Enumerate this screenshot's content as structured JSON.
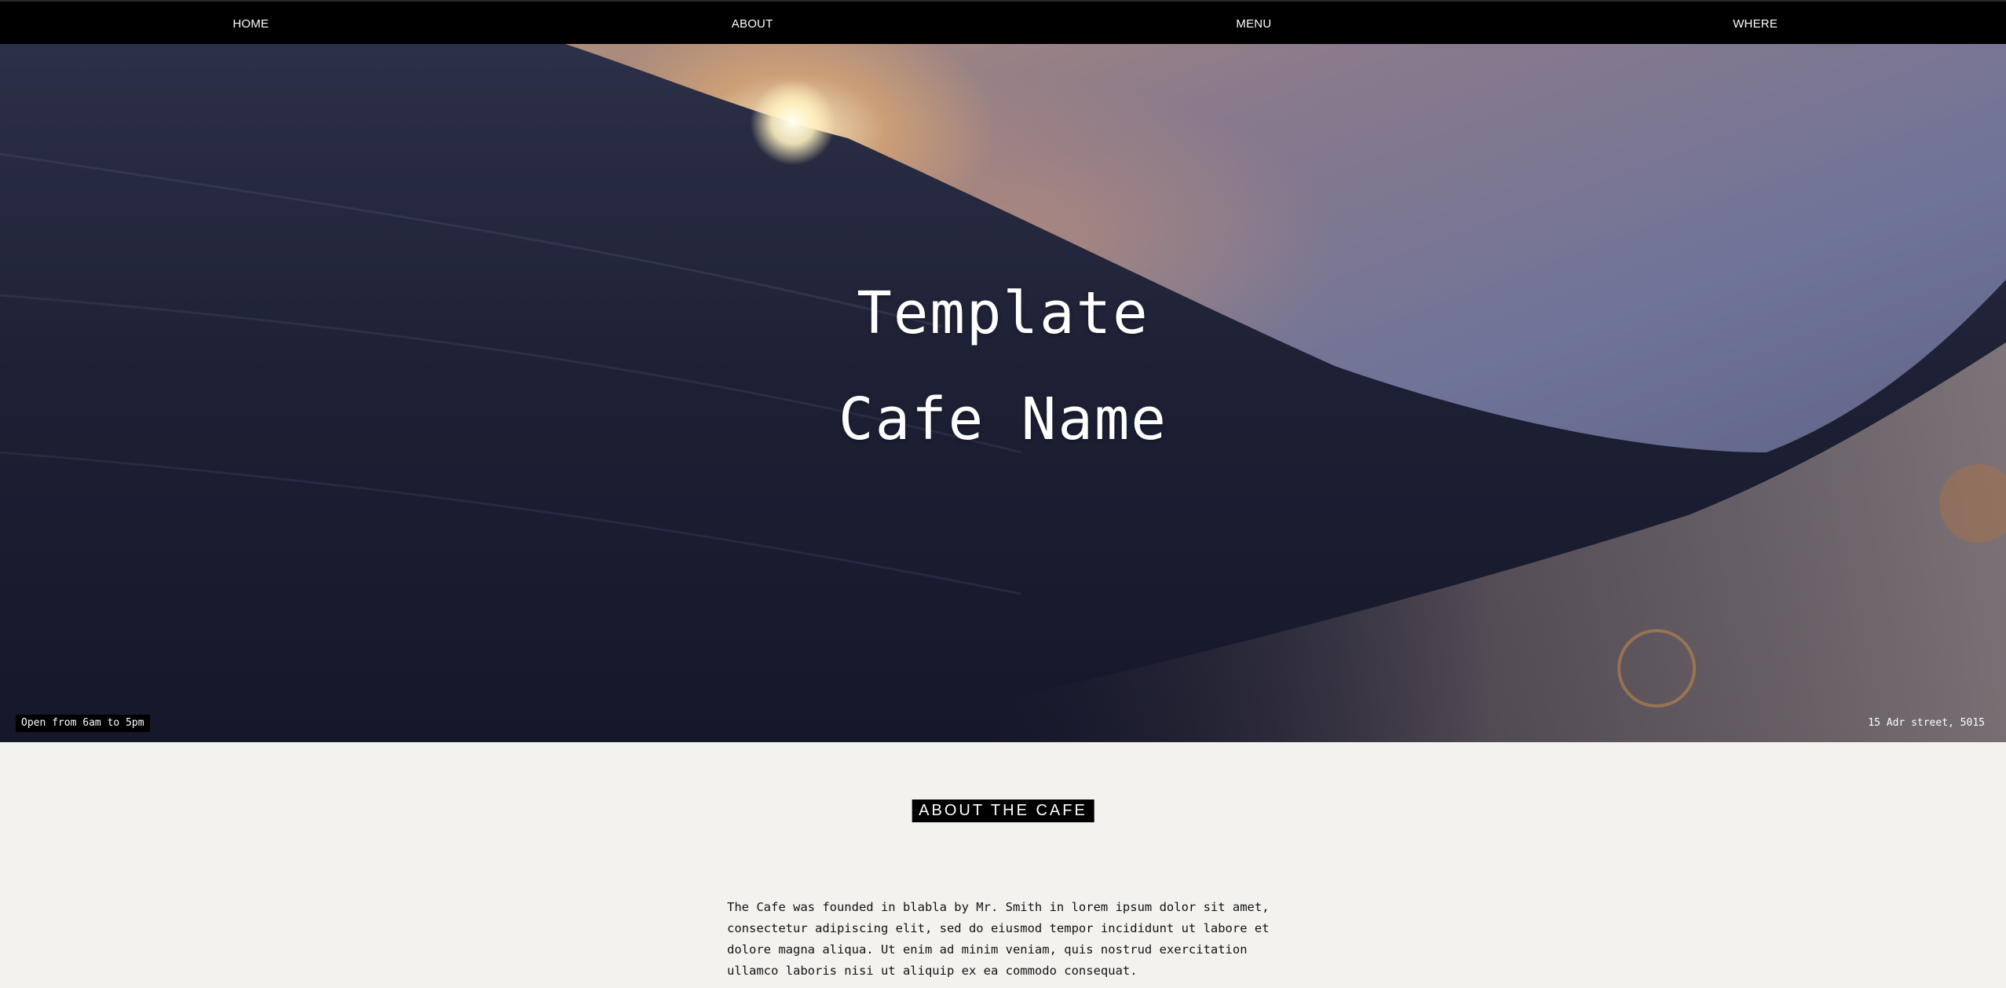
{
  "nav": {
    "items": [
      {
        "label": "HOME"
      },
      {
        "label": "ABOUT"
      },
      {
        "label": "MENU"
      },
      {
        "label": "WHERE"
      }
    ]
  },
  "hero": {
    "title_line1": "Template",
    "title_line2": "Cafe Name",
    "hours": "Open from 6am to 5pm",
    "address": "15 Adr street, 5015"
  },
  "about": {
    "heading": "ABOUT THE CAFE",
    "body": "The Cafe was founded in blabla by Mr. Smith in lorem ipsum dolor sit amet, consectetur adipiscing elit, sed do eiusmod tempor incididunt ut labore et dolore magna aliqua. Ut enim ad minim veniam, quis nostrud exercitation ullamco laboris nisi ut aliquip ex ea commodo consequat."
  },
  "colors": {
    "nav_background": "#000000",
    "page_background": "#f3f2ee",
    "heading_background": "#000000",
    "text": "#111111"
  }
}
